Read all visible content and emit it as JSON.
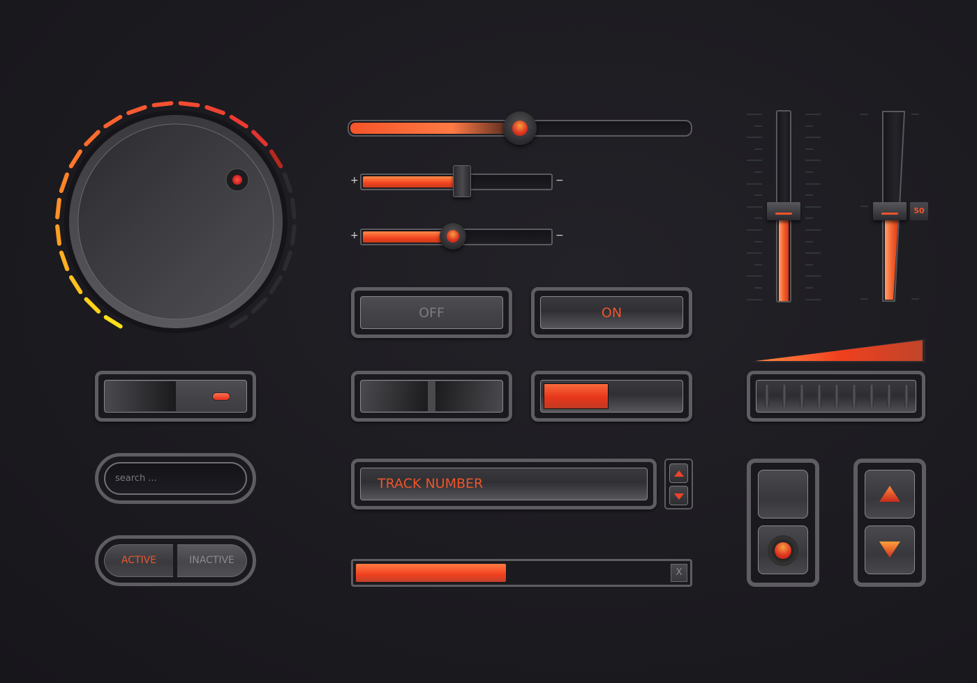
{
  "theme": {
    "background": "#1c1b20",
    "accent": "#f0542a",
    "accent_bright": "#ff7a3c",
    "frame": "#5d5d62",
    "text_muted": "#8a8a8e"
  },
  "knob": {
    "value_percent": 72,
    "segments_total": 24,
    "segments_lit": 17,
    "indicator_color": "#e8302a"
  },
  "sliders": [
    {
      "id": "slider-main",
      "value_percent": 50,
      "style": "round-knob",
      "plus_label": "",
      "minus_label": ""
    },
    {
      "id": "slider-2",
      "value_percent": 49,
      "style": "square-thumb",
      "plus_label": "+",
      "minus_label": "−"
    },
    {
      "id": "slider-3",
      "value_percent": 48,
      "style": "round-knob",
      "plus_label": "+",
      "minus_label": "−"
    }
  ],
  "faders": [
    {
      "id": "fader-left",
      "value_percent": 50
    },
    {
      "id": "fader-right",
      "value_percent": 50,
      "readout": "50"
    }
  ],
  "volume_ramp": {
    "value_percent": 100
  },
  "toggles": {
    "off_button_label": "OFF",
    "on_button_label": "ON",
    "on_active": true,
    "split_switch_state": "neutral",
    "red_switch_state": "on",
    "left_switch_indicator": "on"
  },
  "search": {
    "placeholder": "search ...",
    "value": ""
  },
  "segmented": {
    "active_label": "ACTIVE",
    "inactive_label": "INACTIVE",
    "selected": "ACTIVE"
  },
  "track": {
    "label": "TRACK NUMBER",
    "up_icon": "triangle-up-icon",
    "down_icon": "triangle-down-icon"
  },
  "progress": {
    "value_percent": 48,
    "close_label": "X"
  },
  "grip": {
    "ridges": 9
  },
  "rocker": {
    "top_state": "blank",
    "bottom_state": "record-dot"
  },
  "updown": {
    "up_icon": "triangle-up-icon",
    "down_icon": "triangle-down-icon"
  }
}
